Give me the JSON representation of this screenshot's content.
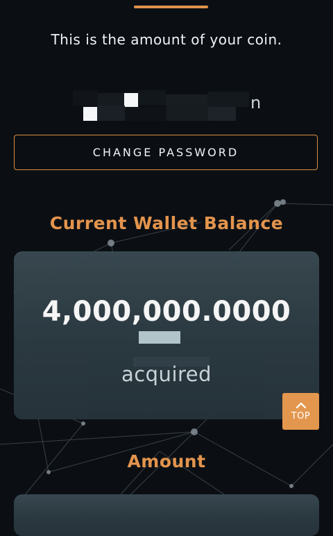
{
  "intro_text": "This is the amount of your coin.",
  "masked_field": {
    "visible_suffix": "n"
  },
  "change_password_button": "CHANGE PASSWORD",
  "wallet": {
    "title": "Current Wallet Balance",
    "balance": "4,000,000.0000",
    "status": "acquired"
  },
  "amount_section": {
    "title": "Amount"
  },
  "scroll_top": {
    "label": "TOP",
    "icon": "chevron-up-icon"
  },
  "colors": {
    "background": "#0b0f14",
    "accent": "#e0924a",
    "card": "#34434b",
    "text": "#f1f4f6"
  }
}
